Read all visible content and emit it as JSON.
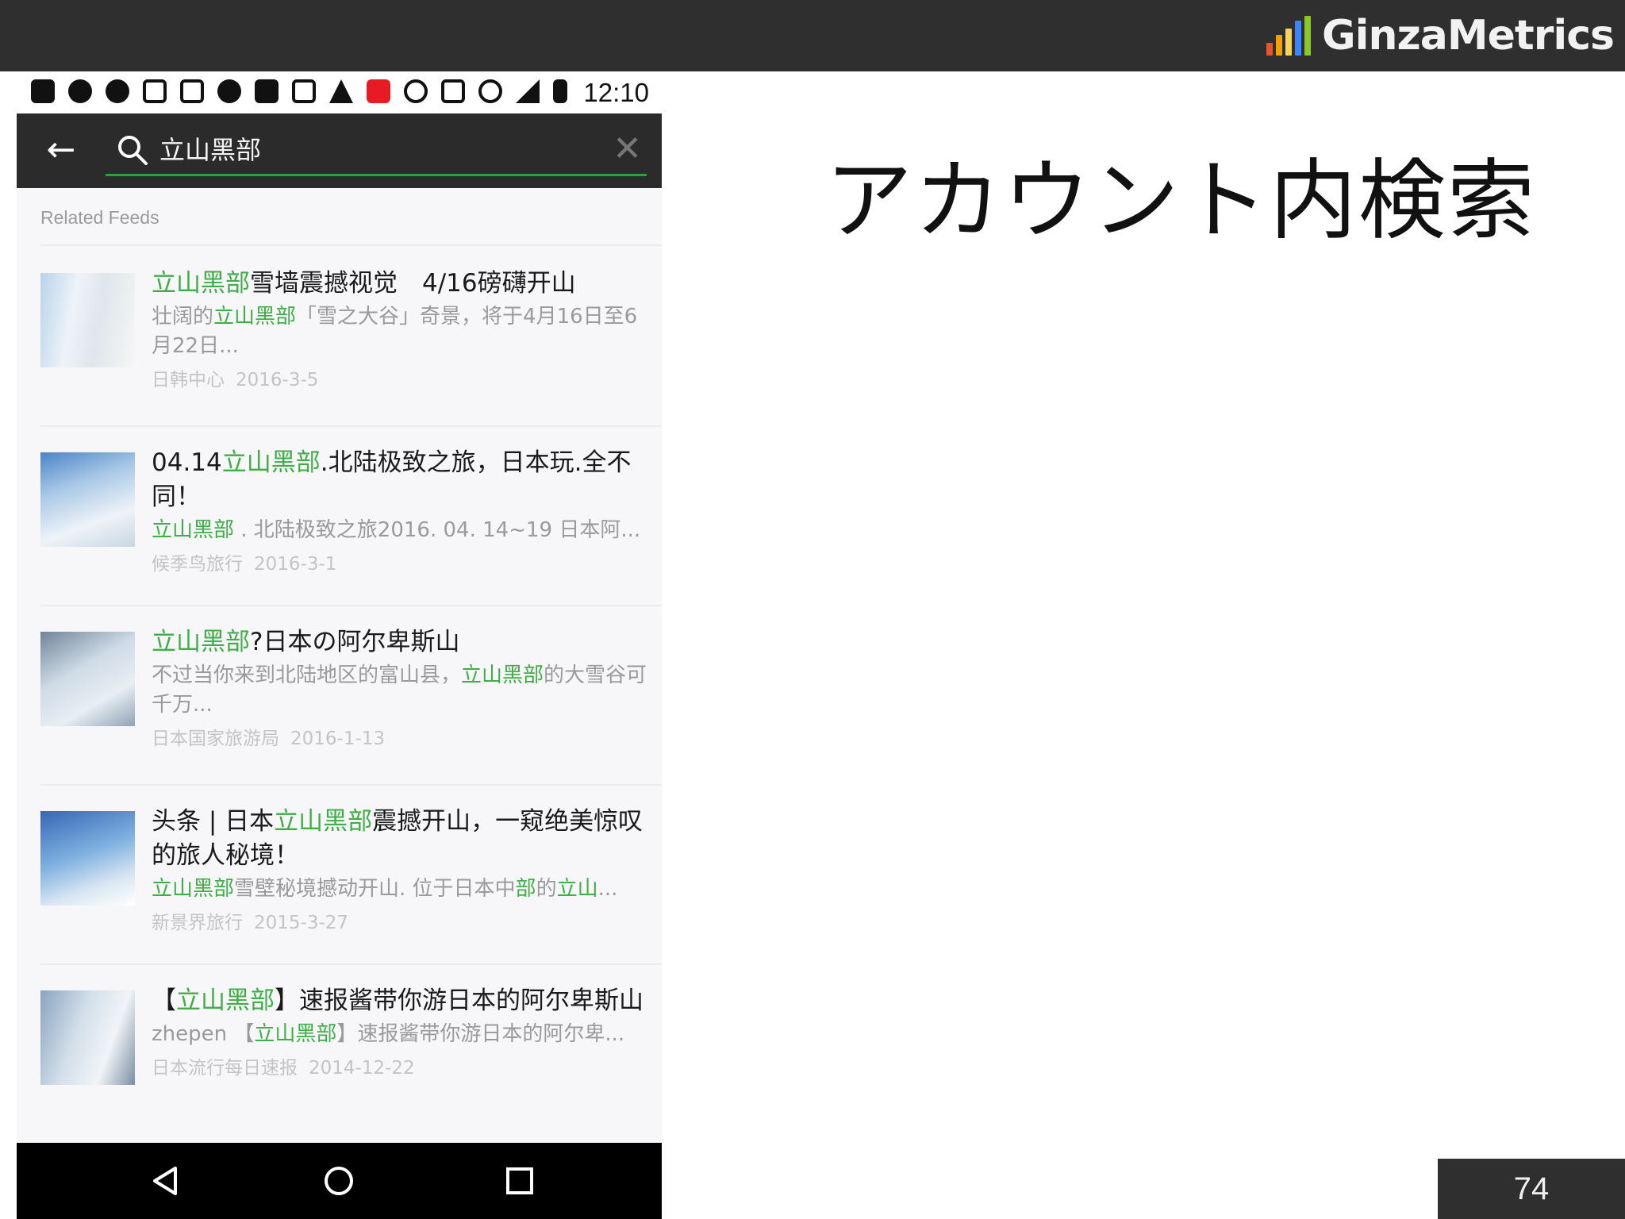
{
  "slide": {
    "title": "アカウント内検索",
    "page_number": "74",
    "brand": {
      "name": "GinzaMetrics",
      "bar_colors": [
        "#e4572e",
        "#f0a202",
        "#f4d35e",
        "#3a86ff",
        "#8ac926"
      ]
    }
  },
  "phone": {
    "status_bar": {
      "time": "12:10"
    },
    "search": {
      "query": "立山黑部",
      "back_icon": "arrow-left-icon",
      "clear_icon": "close-icon"
    },
    "section_label": "Related Feeds",
    "accent_color": "#3fae46",
    "feeds": [
      {
        "title_parts": [
          {
            "t": "立山黑部",
            "hl": true
          },
          {
            "t": "雪墙震撼视觉　4/16磅礴开山",
            "hl": false
          }
        ],
        "summary_parts": [
          {
            "t": "壮阔的",
            "hl": false
          },
          {
            "t": "立山黑部",
            "hl": true
          },
          {
            "t": "「雪之大谷」奇景，将于4月16日至6月22日...",
            "hl": false
          }
        ],
        "source": "日韩中心",
        "date": "2016-3-5"
      },
      {
        "title_parts": [
          {
            "t": "04.14",
            "hl": false
          },
          {
            "t": "立山黑部",
            "hl": true
          },
          {
            "t": ".北陆极致之旅，日本玩.全不同！",
            "hl": false
          }
        ],
        "summary_parts": [
          {
            "t": "立山黑部",
            "hl": true
          },
          {
            "t": " . 北陆极致之旅2016. 04. 14~19 日本阿...",
            "hl": false
          }
        ],
        "source": "候季鸟旅行",
        "date": "2016-3-1"
      },
      {
        "title_parts": [
          {
            "t": "立山黑部",
            "hl": true
          },
          {
            "t": "?日本の阿尔卑斯山",
            "hl": false
          }
        ],
        "summary_parts": [
          {
            "t": "不过当你来到北陆地区的富山县，",
            "hl": false
          },
          {
            "t": "立山黑部",
            "hl": true
          },
          {
            "t": "的大雪谷可千万...",
            "hl": false
          }
        ],
        "source": "日本国家旅游局",
        "date": "2016-1-13"
      },
      {
        "title_parts": [
          {
            "t": "头条 | 日本",
            "hl": false
          },
          {
            "t": "立山黑部",
            "hl": true
          },
          {
            "t": "震撼开山，一窥绝美惊叹的旅人秘境！",
            "hl": false
          }
        ],
        "summary_parts": [
          {
            "t": "立山黑部",
            "hl": true
          },
          {
            "t": "雪壁秘境撼动开山. 位于日本中",
            "hl": false
          },
          {
            "t": "部",
            "hl": true
          },
          {
            "t": "的",
            "hl": false
          },
          {
            "t": "立山",
            "hl": true
          },
          {
            "t": "...",
            "hl": false
          }
        ],
        "source": "新景界旅行",
        "date": "2015-3-27"
      },
      {
        "title_parts": [
          {
            "t": "【",
            "hl": false
          },
          {
            "t": "立山黑部",
            "hl": true
          },
          {
            "t": "】速报酱带你游日本的阿尔卑斯山",
            "hl": false
          }
        ],
        "summary_parts": [
          {
            "t": "zhepen 【",
            "hl": false
          },
          {
            "t": "立山黑部",
            "hl": true
          },
          {
            "t": "】速报酱带你游日本的阿尔卑...",
            "hl": false
          }
        ],
        "source": "日本流行每日速报",
        "date": "2014-12-22"
      }
    ],
    "nav": {
      "back": "triangle-back-icon",
      "home": "circle-home-icon",
      "recents": "square-recents-icon"
    }
  }
}
